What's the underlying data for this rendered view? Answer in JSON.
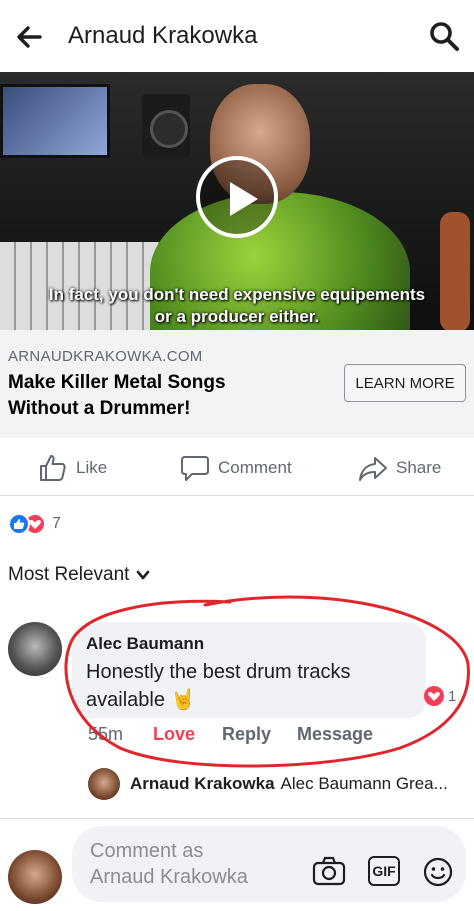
{
  "header": {
    "title": "Arnaud Krakowka",
    "back_icon": "arrow-left-icon",
    "search_icon": "search-icon"
  },
  "video": {
    "subtitle_line1": "In fact, you don't need expensive equipements",
    "subtitle_line2": "or a producer either.",
    "play_icon": "play-icon"
  },
  "link_preview": {
    "domain": "ARNAUDKRAKOWKA.COM",
    "headline_line1": "Make Killer Metal Songs",
    "headline_line2": "Without a Drummer!",
    "cta_label": "LEARN MORE"
  },
  "actions": {
    "like_label": "Like",
    "comment_label": "Comment",
    "share_label": "Share"
  },
  "reactions": {
    "count": "7"
  },
  "sort": {
    "label": "Most Relevant"
  },
  "comment": {
    "author": "Alec Baumann",
    "text": "Honestly the best drum tracks available 🤘",
    "love_count": "1",
    "time": "55m",
    "love_label": "Love",
    "reply_label": "Reply",
    "message_label": "Message"
  },
  "reply_preview": {
    "author": "Arnaud Krakowka",
    "text": "Alec Baumann Grea..."
  },
  "composer": {
    "placeholder_line1": "Comment as",
    "placeholder_line2": "Arnaud Krakowka",
    "gif_label": "GIF"
  },
  "colors": {
    "accent_blue": "#1877f2",
    "love_red": "#f33e58",
    "annotation_red": "#e0262b"
  }
}
